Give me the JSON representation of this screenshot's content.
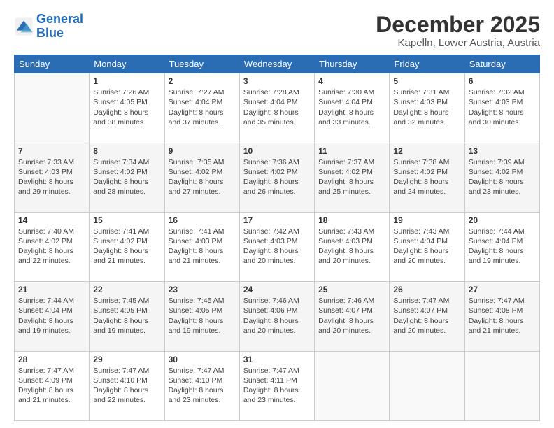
{
  "logo": {
    "line1": "General",
    "line2": "Blue"
  },
  "title": "December 2025",
  "subtitle": "Kapelln, Lower Austria, Austria",
  "days_header": [
    "Sunday",
    "Monday",
    "Tuesday",
    "Wednesday",
    "Thursday",
    "Friday",
    "Saturday"
  ],
  "weeks": [
    [
      {
        "num": "",
        "info": ""
      },
      {
        "num": "1",
        "info": "Sunrise: 7:26 AM\nSunset: 4:05 PM\nDaylight: 8 hours\nand 38 minutes."
      },
      {
        "num": "2",
        "info": "Sunrise: 7:27 AM\nSunset: 4:04 PM\nDaylight: 8 hours\nand 37 minutes."
      },
      {
        "num": "3",
        "info": "Sunrise: 7:28 AM\nSunset: 4:04 PM\nDaylight: 8 hours\nand 35 minutes."
      },
      {
        "num": "4",
        "info": "Sunrise: 7:30 AM\nSunset: 4:04 PM\nDaylight: 8 hours\nand 33 minutes."
      },
      {
        "num": "5",
        "info": "Sunrise: 7:31 AM\nSunset: 4:03 PM\nDaylight: 8 hours\nand 32 minutes."
      },
      {
        "num": "6",
        "info": "Sunrise: 7:32 AM\nSunset: 4:03 PM\nDaylight: 8 hours\nand 30 minutes."
      }
    ],
    [
      {
        "num": "7",
        "info": "Sunrise: 7:33 AM\nSunset: 4:03 PM\nDaylight: 8 hours\nand 29 minutes."
      },
      {
        "num": "8",
        "info": "Sunrise: 7:34 AM\nSunset: 4:02 PM\nDaylight: 8 hours\nand 28 minutes."
      },
      {
        "num": "9",
        "info": "Sunrise: 7:35 AM\nSunset: 4:02 PM\nDaylight: 8 hours\nand 27 minutes."
      },
      {
        "num": "10",
        "info": "Sunrise: 7:36 AM\nSunset: 4:02 PM\nDaylight: 8 hours\nand 26 minutes."
      },
      {
        "num": "11",
        "info": "Sunrise: 7:37 AM\nSunset: 4:02 PM\nDaylight: 8 hours\nand 25 minutes."
      },
      {
        "num": "12",
        "info": "Sunrise: 7:38 AM\nSunset: 4:02 PM\nDaylight: 8 hours\nand 24 minutes."
      },
      {
        "num": "13",
        "info": "Sunrise: 7:39 AM\nSunset: 4:02 PM\nDaylight: 8 hours\nand 23 minutes."
      }
    ],
    [
      {
        "num": "14",
        "info": "Sunrise: 7:40 AM\nSunset: 4:02 PM\nDaylight: 8 hours\nand 22 minutes."
      },
      {
        "num": "15",
        "info": "Sunrise: 7:41 AM\nSunset: 4:02 PM\nDaylight: 8 hours\nand 21 minutes."
      },
      {
        "num": "16",
        "info": "Sunrise: 7:41 AM\nSunset: 4:03 PM\nDaylight: 8 hours\nand 21 minutes."
      },
      {
        "num": "17",
        "info": "Sunrise: 7:42 AM\nSunset: 4:03 PM\nDaylight: 8 hours\nand 20 minutes."
      },
      {
        "num": "18",
        "info": "Sunrise: 7:43 AM\nSunset: 4:03 PM\nDaylight: 8 hours\nand 20 minutes."
      },
      {
        "num": "19",
        "info": "Sunrise: 7:43 AM\nSunset: 4:04 PM\nDaylight: 8 hours\nand 20 minutes."
      },
      {
        "num": "20",
        "info": "Sunrise: 7:44 AM\nSunset: 4:04 PM\nDaylight: 8 hours\nand 19 minutes."
      }
    ],
    [
      {
        "num": "21",
        "info": "Sunrise: 7:44 AM\nSunset: 4:04 PM\nDaylight: 8 hours\nand 19 minutes."
      },
      {
        "num": "22",
        "info": "Sunrise: 7:45 AM\nSunset: 4:05 PM\nDaylight: 8 hours\nand 19 minutes."
      },
      {
        "num": "23",
        "info": "Sunrise: 7:45 AM\nSunset: 4:05 PM\nDaylight: 8 hours\nand 19 minutes."
      },
      {
        "num": "24",
        "info": "Sunrise: 7:46 AM\nSunset: 4:06 PM\nDaylight: 8 hours\nand 20 minutes."
      },
      {
        "num": "25",
        "info": "Sunrise: 7:46 AM\nSunset: 4:07 PM\nDaylight: 8 hours\nand 20 minutes."
      },
      {
        "num": "26",
        "info": "Sunrise: 7:47 AM\nSunset: 4:07 PM\nDaylight: 8 hours\nand 20 minutes."
      },
      {
        "num": "27",
        "info": "Sunrise: 7:47 AM\nSunset: 4:08 PM\nDaylight: 8 hours\nand 21 minutes."
      }
    ],
    [
      {
        "num": "28",
        "info": "Sunrise: 7:47 AM\nSunset: 4:09 PM\nDaylight: 8 hours\nand 21 minutes."
      },
      {
        "num": "29",
        "info": "Sunrise: 7:47 AM\nSunset: 4:10 PM\nDaylight: 8 hours\nand 22 minutes."
      },
      {
        "num": "30",
        "info": "Sunrise: 7:47 AM\nSunset: 4:10 PM\nDaylight: 8 hours\nand 23 minutes."
      },
      {
        "num": "31",
        "info": "Sunrise: 7:47 AM\nSunset: 4:11 PM\nDaylight: 8 hours\nand 23 minutes."
      },
      {
        "num": "",
        "info": ""
      },
      {
        "num": "",
        "info": ""
      },
      {
        "num": "",
        "info": ""
      }
    ]
  ]
}
